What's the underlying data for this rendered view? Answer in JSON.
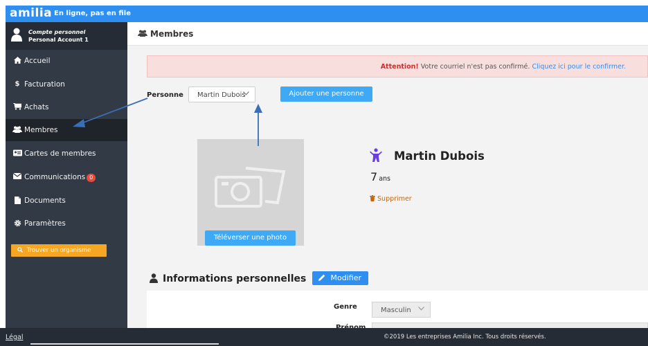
{
  "brand": {
    "logo": "amilia",
    "tagline": "En ligne, pas en file"
  },
  "account": {
    "title": "Compte personnel",
    "name": "Personal Account 1"
  },
  "sidebar": {
    "items": [
      {
        "label": "Accueil",
        "icon": "home-icon"
      },
      {
        "label": "Facturation",
        "icon": "dollar-icon"
      },
      {
        "label": "Achats",
        "icon": "cart-icon"
      },
      {
        "label": "Membres",
        "icon": "users-icon",
        "active": true
      },
      {
        "label": "Cartes de membres",
        "icon": "card-icon"
      },
      {
        "label": "Communications",
        "icon": "envelope-icon",
        "badge": "0"
      },
      {
        "label": "Documents",
        "icon": "document-icon"
      },
      {
        "label": "Paramètres",
        "icon": "gear-icon"
      }
    ],
    "find_label": "Trouver un organisme"
  },
  "page": {
    "title": "Membres"
  },
  "alert": {
    "strong": "Attention!",
    "message": "Votre courriel n'est pas confirmé.",
    "link": "Cliquez ici pour le confirmer."
  },
  "person": {
    "label": "Personne",
    "selected": "Martin Dubois",
    "add_label": "Ajouter une personne"
  },
  "profile": {
    "name": "Martin Dubois",
    "age": "7",
    "age_unit": "ans",
    "delete_label": "Supprimer",
    "upload_label": "Téléverser une photo"
  },
  "info": {
    "title": "Informations personnelles",
    "edit_label": "Modifier",
    "genre_label": "Genre",
    "genre_value": "Masculin",
    "next_label": "Prénom"
  },
  "footer": {
    "legal": "Légal",
    "copyright": "©2019 Les entreprises Amilia Inc. Tous droits réservés."
  },
  "colors": {
    "primary": "#2e8ff0",
    "button": "#3fa9f5",
    "sidebar": "#323a45",
    "alert_bg": "#f9dede",
    "accent": "#f5a623",
    "annotation_arrow": "#3a6fb5"
  }
}
